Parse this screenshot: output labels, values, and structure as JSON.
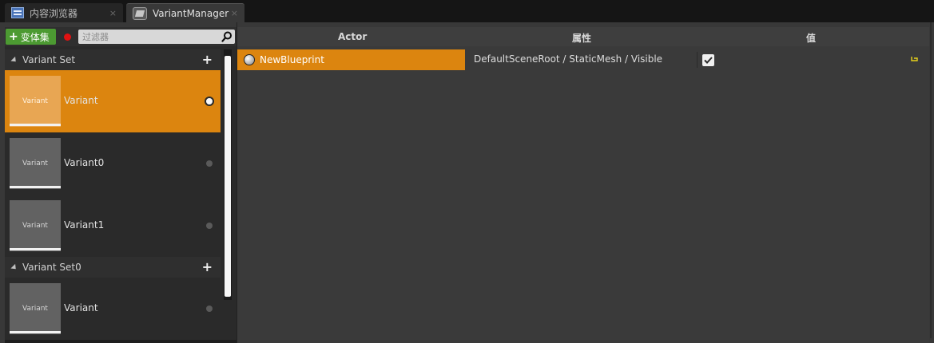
{
  "tabs": [
    {
      "label": "内容浏览器",
      "icon": "content-browser-icon",
      "close": "×"
    },
    {
      "label": "VariantManager",
      "icon": "variant-manager-icon",
      "close": "×"
    }
  ],
  "toolbar": {
    "add_variant_set_label": "变体集",
    "filter_placeholder": "过滤器"
  },
  "variant_sets": [
    {
      "title": "Variant Set",
      "add": "+",
      "variants": [
        {
          "name": "Variant",
          "thumbnail_label": "Variant",
          "selected": true
        },
        {
          "name": "Variant0",
          "thumbnail_label": "Variant",
          "selected": false
        },
        {
          "name": "Variant1",
          "thumbnail_label": "Variant",
          "selected": false
        }
      ]
    },
    {
      "title": "Variant Set0",
      "add": "+",
      "variants": [
        {
          "name": "Variant",
          "thumbnail_label": "Variant",
          "selected": false
        }
      ]
    }
  ],
  "columns": {
    "actor": "Actor",
    "property": "属性",
    "value": "值"
  },
  "bindings": [
    {
      "actor": "NewBlueprint",
      "property": "DefaultSceneRoot / StaticMesh / Visible",
      "value_checked": true
    }
  ],
  "colors": {
    "selection": "#dc850f",
    "add_button": "#4c9a32",
    "record": "#e01212"
  }
}
